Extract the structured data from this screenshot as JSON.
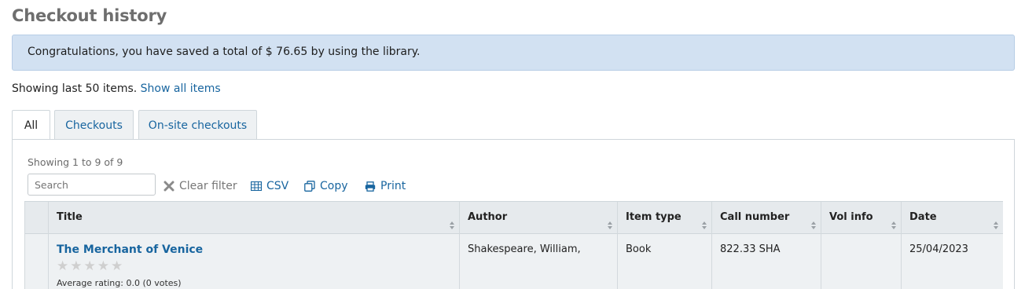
{
  "page": {
    "title": "Checkout history"
  },
  "alert": {
    "text": "Congratulations, you have saved a total of $ 76.65 by using the library."
  },
  "showing": {
    "text": "Showing last 50 items.",
    "link": "Show all items"
  },
  "tabs": [
    {
      "label": "All",
      "active": true
    },
    {
      "label": "Checkouts",
      "active": false
    },
    {
      "label": "On-site checkouts",
      "active": false
    }
  ],
  "table_info": "Showing 1 to 9 of 9",
  "search": {
    "placeholder": "Search",
    "value": ""
  },
  "toolbar": {
    "clear_filter": "Clear filter",
    "csv": "CSV",
    "copy": "Copy",
    "print": "Print"
  },
  "columns": [
    "Title",
    "Author",
    "Item type",
    "Call number",
    "Vol info",
    "Date"
  ],
  "rows": [
    {
      "title": "The Merchant of Venice",
      "rating_text": "Average rating: 0.0 (0 votes)",
      "rating_stars": 0,
      "author": "Shakespeare, William,",
      "item_type": "Book",
      "call_number": "822.33 SHA",
      "vol_info": "",
      "date": "25/04/2023"
    }
  ],
  "colors": {
    "link": "#18659f",
    "alert_bg": "#d2e1f2",
    "header_bg": "#e6eaed"
  }
}
